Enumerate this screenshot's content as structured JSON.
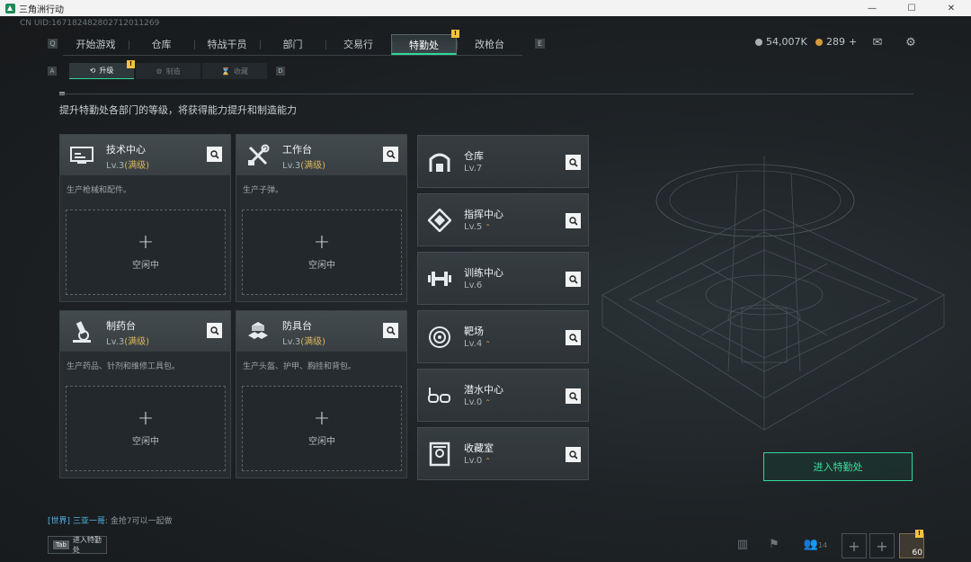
{
  "window": {
    "title": "三角洲行动",
    "minimize": "—",
    "maximize": "☐",
    "close": "✕"
  },
  "uid": "CN UID:16718248280271201126​9",
  "nav": {
    "key_left": "Q",
    "key_right": "E",
    "tabs": [
      "开始游戏",
      "仓库",
      "特战干员",
      "部门",
      "交易行",
      "特勤处",
      "改枪台"
    ],
    "active_index": 5,
    "badge": "!"
  },
  "currency": {
    "silver": "54,007K",
    "gold": "289",
    "add": "+"
  },
  "subnav": {
    "key_left": "A",
    "key_right": "D",
    "tabs": [
      "升级",
      "制造",
      "收藏"
    ],
    "active_index": 0,
    "badge": "!"
  },
  "intro": "提升特勤处各部门的等级，将获得能力提升和制造能力",
  "big_cards": [
    {
      "name": "技术中心",
      "lv": "Lv.3",
      "max": "(满级)",
      "desc": "生产枪械和配件。",
      "idle": "空闲中",
      "icon": "computer-icon"
    },
    {
      "name": "工作台",
      "lv": "Lv.3",
      "max": "(满级)",
      "desc": "生产子弹。",
      "idle": "空闲中",
      "icon": "tools-icon"
    },
    {
      "name": "制药台",
      "lv": "Lv.3",
      "max": "(满级)",
      "desc": "生产药品、针剂和维修工具包。",
      "idle": "空闲中",
      "icon": "microscope-icon"
    },
    {
      "name": "防具台",
      "lv": "Lv.3",
      "max": "(满级)",
      "desc": "生产头盔、护甲、胸挂和背包。",
      "idle": "空闲中",
      "icon": "cubes-icon"
    }
  ],
  "small_cards": [
    {
      "name": "仓库",
      "lv": "Lv.7",
      "upgradable": false,
      "icon": "warehouse-icon"
    },
    {
      "name": "指挥中心",
      "lv": "Lv.5",
      "upgradable": true,
      "icon": "command-icon"
    },
    {
      "name": "训练中心",
      "lv": "Lv.6",
      "upgradable": false,
      "icon": "dumbbell-icon"
    },
    {
      "name": "靶场",
      "lv": "Lv.4",
      "upgradable": true,
      "icon": "target-icon"
    },
    {
      "name": "潜水中心",
      "lv": "Lv.0",
      "upgradable": true,
      "icon": "diving-mask-icon"
    },
    {
      "name": "收藏室",
      "lv": "Lv.0",
      "upgradable": true,
      "icon": "collection-icon"
    }
  ],
  "enter_button": "进入特勤处",
  "chat": {
    "channel": "[世界]",
    "sender": "三亚一哥",
    "message": "金抢7可以一起做"
  },
  "tab_hint": {
    "key": "Tab",
    "label": "进入特勤处"
  },
  "bottom": {
    "friends_count": "14",
    "avatar_level": "60",
    "avatar_badge": "!"
  },
  "colors": {
    "accent": "#2fd99a",
    "max_level": "#d9b45a",
    "badge": "#f3c43d"
  }
}
